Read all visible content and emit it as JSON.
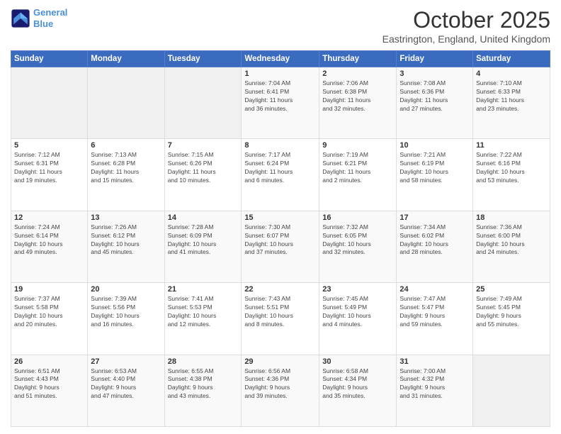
{
  "header": {
    "logo_line1": "General",
    "logo_line2": "Blue",
    "month": "October 2025",
    "location": "Eastrington, England, United Kingdom"
  },
  "days_of_week": [
    "Sunday",
    "Monday",
    "Tuesday",
    "Wednesday",
    "Thursday",
    "Friday",
    "Saturday"
  ],
  "weeks": [
    [
      {
        "num": "",
        "info": ""
      },
      {
        "num": "",
        "info": ""
      },
      {
        "num": "",
        "info": ""
      },
      {
        "num": "1",
        "info": "Sunrise: 7:04 AM\nSunset: 6:41 PM\nDaylight: 11 hours\nand 36 minutes."
      },
      {
        "num": "2",
        "info": "Sunrise: 7:06 AM\nSunset: 6:38 PM\nDaylight: 11 hours\nand 32 minutes."
      },
      {
        "num": "3",
        "info": "Sunrise: 7:08 AM\nSunset: 6:36 PM\nDaylight: 11 hours\nand 27 minutes."
      },
      {
        "num": "4",
        "info": "Sunrise: 7:10 AM\nSunset: 6:33 PM\nDaylight: 11 hours\nand 23 minutes."
      }
    ],
    [
      {
        "num": "5",
        "info": "Sunrise: 7:12 AM\nSunset: 6:31 PM\nDaylight: 11 hours\nand 19 minutes."
      },
      {
        "num": "6",
        "info": "Sunrise: 7:13 AM\nSunset: 6:28 PM\nDaylight: 11 hours\nand 15 minutes."
      },
      {
        "num": "7",
        "info": "Sunrise: 7:15 AM\nSunset: 6:26 PM\nDaylight: 11 hours\nand 10 minutes."
      },
      {
        "num": "8",
        "info": "Sunrise: 7:17 AM\nSunset: 6:24 PM\nDaylight: 11 hours\nand 6 minutes."
      },
      {
        "num": "9",
        "info": "Sunrise: 7:19 AM\nSunset: 6:21 PM\nDaylight: 11 hours\nand 2 minutes."
      },
      {
        "num": "10",
        "info": "Sunrise: 7:21 AM\nSunset: 6:19 PM\nDaylight: 10 hours\nand 58 minutes."
      },
      {
        "num": "11",
        "info": "Sunrise: 7:22 AM\nSunset: 6:16 PM\nDaylight: 10 hours\nand 53 minutes."
      }
    ],
    [
      {
        "num": "12",
        "info": "Sunrise: 7:24 AM\nSunset: 6:14 PM\nDaylight: 10 hours\nand 49 minutes."
      },
      {
        "num": "13",
        "info": "Sunrise: 7:26 AM\nSunset: 6:12 PM\nDaylight: 10 hours\nand 45 minutes."
      },
      {
        "num": "14",
        "info": "Sunrise: 7:28 AM\nSunset: 6:09 PM\nDaylight: 10 hours\nand 41 minutes."
      },
      {
        "num": "15",
        "info": "Sunrise: 7:30 AM\nSunset: 6:07 PM\nDaylight: 10 hours\nand 37 minutes."
      },
      {
        "num": "16",
        "info": "Sunrise: 7:32 AM\nSunset: 6:05 PM\nDaylight: 10 hours\nand 32 minutes."
      },
      {
        "num": "17",
        "info": "Sunrise: 7:34 AM\nSunset: 6:02 PM\nDaylight: 10 hours\nand 28 minutes."
      },
      {
        "num": "18",
        "info": "Sunrise: 7:36 AM\nSunset: 6:00 PM\nDaylight: 10 hours\nand 24 minutes."
      }
    ],
    [
      {
        "num": "19",
        "info": "Sunrise: 7:37 AM\nSunset: 5:58 PM\nDaylight: 10 hours\nand 20 minutes."
      },
      {
        "num": "20",
        "info": "Sunrise: 7:39 AM\nSunset: 5:56 PM\nDaylight: 10 hours\nand 16 minutes."
      },
      {
        "num": "21",
        "info": "Sunrise: 7:41 AM\nSunset: 5:53 PM\nDaylight: 10 hours\nand 12 minutes."
      },
      {
        "num": "22",
        "info": "Sunrise: 7:43 AM\nSunset: 5:51 PM\nDaylight: 10 hours\nand 8 minutes."
      },
      {
        "num": "23",
        "info": "Sunrise: 7:45 AM\nSunset: 5:49 PM\nDaylight: 10 hours\nand 4 minutes."
      },
      {
        "num": "24",
        "info": "Sunrise: 7:47 AM\nSunset: 5:47 PM\nDaylight: 9 hours\nand 59 minutes."
      },
      {
        "num": "25",
        "info": "Sunrise: 7:49 AM\nSunset: 5:45 PM\nDaylight: 9 hours\nand 55 minutes."
      }
    ],
    [
      {
        "num": "26",
        "info": "Sunrise: 6:51 AM\nSunset: 4:43 PM\nDaylight: 9 hours\nand 51 minutes."
      },
      {
        "num": "27",
        "info": "Sunrise: 6:53 AM\nSunset: 4:40 PM\nDaylight: 9 hours\nand 47 minutes."
      },
      {
        "num": "28",
        "info": "Sunrise: 6:55 AM\nSunset: 4:38 PM\nDaylight: 9 hours\nand 43 minutes."
      },
      {
        "num": "29",
        "info": "Sunrise: 6:56 AM\nSunset: 4:36 PM\nDaylight: 9 hours\nand 39 minutes."
      },
      {
        "num": "30",
        "info": "Sunrise: 6:58 AM\nSunset: 4:34 PM\nDaylight: 9 hours\nand 35 minutes."
      },
      {
        "num": "31",
        "info": "Sunrise: 7:00 AM\nSunset: 4:32 PM\nDaylight: 9 hours\nand 31 minutes."
      },
      {
        "num": "",
        "info": ""
      }
    ]
  ]
}
